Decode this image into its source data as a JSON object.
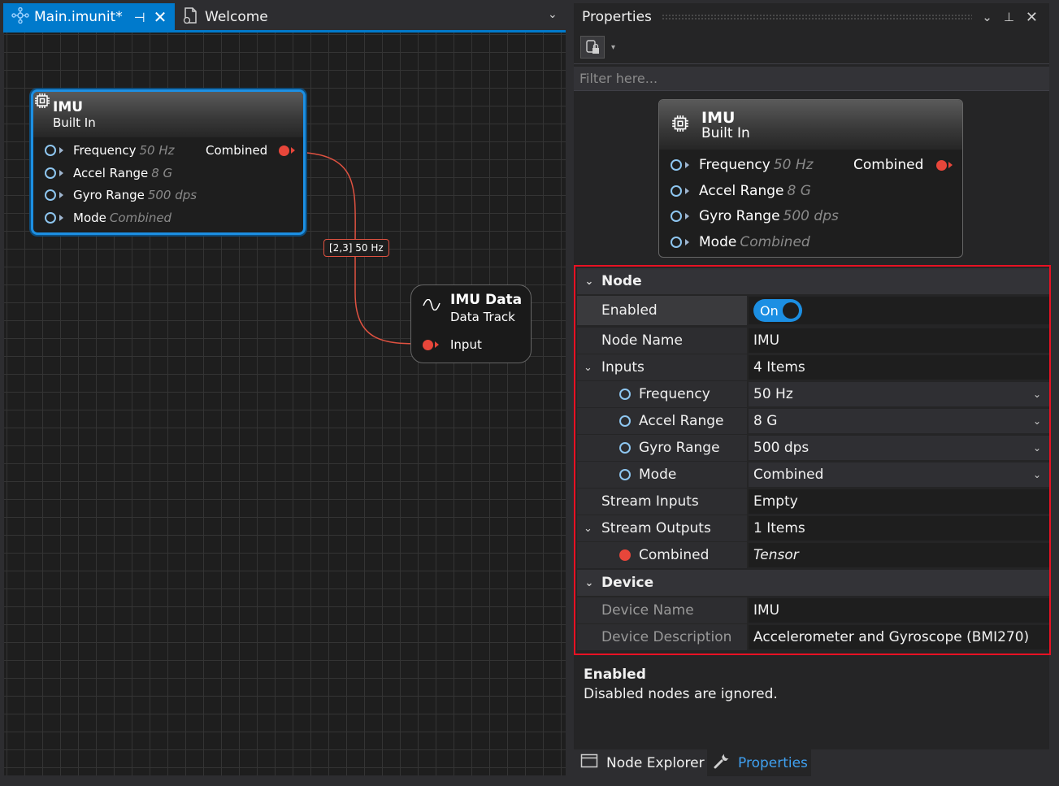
{
  "document_tabs": [
    {
      "label": "Main.imunit*",
      "active": true
    },
    {
      "label": "Welcome",
      "active": false
    }
  ],
  "graph": {
    "imu_node": {
      "title": "IMU",
      "subtitle": "Built In",
      "inputs": [
        {
          "label": "Frequency",
          "hint": "50 Hz"
        },
        {
          "label": "Accel Range",
          "hint": "8 G"
        },
        {
          "label": "Gyro Range",
          "hint": "500 dps"
        },
        {
          "label": "Mode",
          "hint": "Combined"
        }
      ],
      "output": "Combined"
    },
    "edge_label": "[2,3] 50 Hz",
    "data_node": {
      "title": "IMU Data",
      "subtitle": "Data Track",
      "input": "Input"
    }
  },
  "properties": {
    "title": "Properties",
    "filter_placeholder": "Filter here...",
    "preview": {
      "title": "IMU",
      "subtitle": "Built In",
      "inputs": [
        {
          "label": "Frequency",
          "hint": "50 Hz"
        },
        {
          "label": "Accel Range",
          "hint": "8 G"
        },
        {
          "label": "Gyro Range",
          "hint": "500 dps"
        },
        {
          "label": "Mode",
          "hint": "Combined"
        }
      ],
      "output": "Combined"
    },
    "node_category": "Node",
    "enabled_label": "Enabled",
    "enabled_value": "On",
    "node_name_label": "Node Name",
    "node_name_value": "IMU",
    "inputs_label": "Inputs",
    "inputs_value": "4 Items",
    "input_rows": [
      {
        "label": "Frequency",
        "value": "50 Hz"
      },
      {
        "label": "Accel Range",
        "value": "8 G"
      },
      {
        "label": "Gyro Range",
        "value": "500 dps"
      },
      {
        "label": "Mode",
        "value": "Combined"
      }
    ],
    "stream_inputs_label": "Stream Inputs",
    "stream_inputs_value": "Empty",
    "stream_outputs_label": "Stream Outputs",
    "stream_outputs_value": "1 Items",
    "combined_label": "Combined",
    "combined_value": "Tensor",
    "device_category": "Device",
    "device_name_label": "Device Name",
    "device_name_value": "IMU",
    "device_desc_label": "Device Description",
    "device_desc_value": "Accelerometer and Gyroscope (BMI270)",
    "description_title": "Enabled",
    "description_text": "Disabled nodes are ignored."
  },
  "bottom_tabs": [
    {
      "label": "Node Explorer",
      "active": false
    },
    {
      "label": "Properties",
      "active": true
    }
  ],
  "colors": {
    "accent": "#007acc",
    "selection": "#1c8fe3",
    "port_out": "#e8463a",
    "highlight_box": "#e81123"
  }
}
